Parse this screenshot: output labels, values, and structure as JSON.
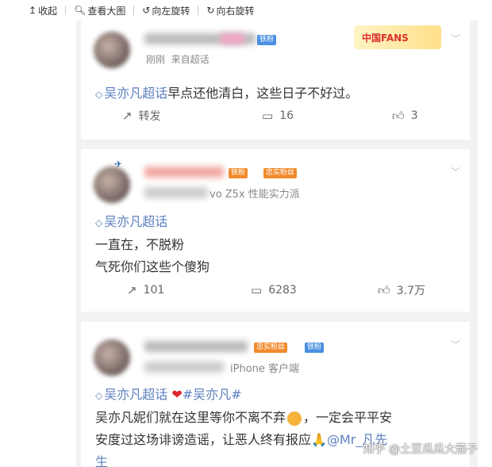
{
  "toolbar": {
    "collapse_label": "收起",
    "view_large_label": "查看大图",
    "rotate_left_label": "向左旋转",
    "rotate_right_label": "向右旋转"
  },
  "posts": [
    {
      "time": "刚刚",
      "source": "来自超话",
      "badge_iron": "铁粉",
      "fans_badge": "中国FANS",
      "topic": "吴亦凡超话",
      "text_lines": [
        "早点还他清白，这些日子不好过。"
      ],
      "reposts_label": "转发",
      "comments": "16",
      "likes": "3"
    },
    {
      "source": "vo Z5x 性能实力派",
      "badge_iron": "铁粉",
      "badge_loyal": "忠实粉丝",
      "topic": "吴亦凡超话",
      "text_lines": [
        "一直在，不脱粉",
        "气死你们这些个傻狗"
      ],
      "reposts": "101",
      "comments": "6283",
      "likes": "3.7万"
    },
    {
      "source": "iPhone 客户端",
      "badge_iron": "铁粉",
      "badge_loyal": "忠实粉丝",
      "topic": "吴亦凡超话",
      "hashtag": "#吴亦凡#",
      "text_line1": "吴亦凡妮们就在这里等你不离不弃",
      "text_line1_after": "，一定会平平安",
      "text_line2": "安度过这场诽谤造谣，让恶人终有报应",
      "text_line2_mention": "@Mr_凡先",
      "text_line3": "生"
    }
  ],
  "watermark": "知乎 @土豆瓜瓜大茄子"
}
